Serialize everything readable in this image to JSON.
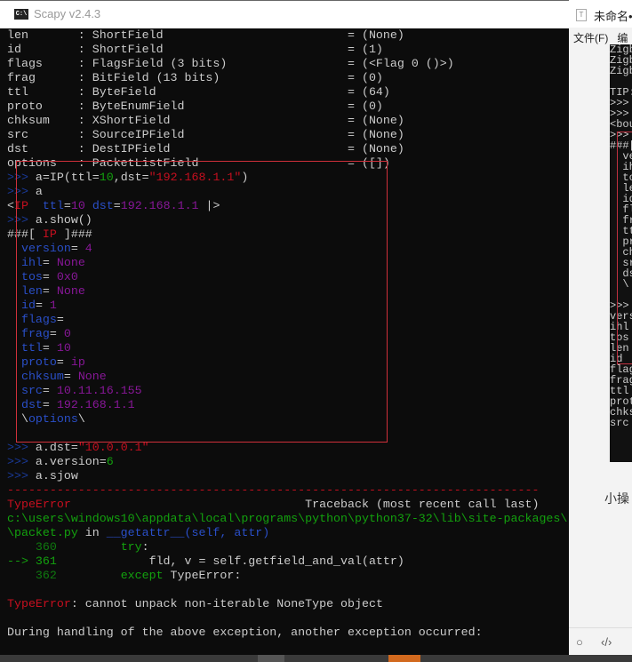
{
  "window": {
    "title": "Scapy v2.4.3",
    "icon": "cmd-icon"
  },
  "terminal": {
    "lines": [
      [
        [
          "w",
          "len       : ShortField                          = (None)"
        ]
      ],
      [
        [
          "w",
          "id        : ShortField                          = (1)"
        ]
      ],
      [
        [
          "w",
          "flags     : FlagsField (3 bits)                 = (<Flag 0 ()>)"
        ]
      ],
      [
        [
          "w",
          "frag      : BitField (13 bits)                  = (0)"
        ]
      ],
      [
        [
          "w",
          "ttl       : ByteField                           = (64)"
        ]
      ],
      [
        [
          "w",
          "proto     : ByteEnumField                       = (0)"
        ]
      ],
      [
        [
          "w",
          "chksum    : XShortField                         = (None)"
        ]
      ],
      [
        [
          "w",
          "src       : SourceIPField                       = (None)"
        ]
      ],
      [
        [
          "w",
          "dst       : DestIPField                         = (None)"
        ]
      ],
      [
        [
          "w",
          "options   : PacketListField                     = ([])"
        ]
      ],
      [
        [
          "p",
          ">>> "
        ],
        [
          "w",
          "a=IP(ttl="
        ],
        [
          "g",
          "10"
        ],
        [
          "w",
          ",dst="
        ],
        [
          "r",
          "\"192.168.1.1\""
        ],
        [
          "w",
          ")"
        ]
      ],
      [
        [
          "p",
          ">>> "
        ],
        [
          "w",
          "a"
        ]
      ],
      [
        [
          "w",
          "<"
        ],
        [
          "r",
          "IP"
        ],
        [
          "w",
          "  "
        ],
        [
          "b",
          "ttl"
        ],
        [
          "w",
          "="
        ],
        [
          "m",
          "10"
        ],
        [
          "w",
          " "
        ],
        [
          "b",
          "dst"
        ],
        [
          "w",
          "="
        ],
        [
          "m",
          "192.168.1.1"
        ],
        [
          "w",
          " |>"
        ]
      ],
      [
        [
          "p",
          ">>> "
        ],
        [
          "w",
          "a.show()"
        ]
      ],
      [
        [
          "w",
          "###[ "
        ],
        [
          "r",
          "IP"
        ],
        [
          "w",
          " ]###"
        ]
      ],
      [
        [
          "w",
          "  "
        ],
        [
          "b",
          "version"
        ],
        [
          "w",
          "= "
        ],
        [
          "m",
          "4"
        ]
      ],
      [
        [
          "w",
          "  "
        ],
        [
          "b",
          "ihl"
        ],
        [
          "w",
          "= "
        ],
        [
          "m",
          "None"
        ]
      ],
      [
        [
          "w",
          "  "
        ],
        [
          "b",
          "tos"
        ],
        [
          "w",
          "= "
        ],
        [
          "m",
          "0x0"
        ]
      ],
      [
        [
          "w",
          "  "
        ],
        [
          "b",
          "len"
        ],
        [
          "w",
          "= "
        ],
        [
          "m",
          "None"
        ]
      ],
      [
        [
          "w",
          "  "
        ],
        [
          "b",
          "id"
        ],
        [
          "w",
          "= "
        ],
        [
          "m",
          "1"
        ]
      ],
      [
        [
          "w",
          "  "
        ],
        [
          "b",
          "flags"
        ],
        [
          "w",
          "= "
        ]
      ],
      [
        [
          "w",
          "  "
        ],
        [
          "b",
          "frag"
        ],
        [
          "w",
          "= "
        ],
        [
          "m",
          "0"
        ]
      ],
      [
        [
          "w",
          "  "
        ],
        [
          "b",
          "ttl"
        ],
        [
          "w",
          "= "
        ],
        [
          "m",
          "10"
        ]
      ],
      [
        [
          "w",
          "  "
        ],
        [
          "b",
          "proto"
        ],
        [
          "w",
          "= "
        ],
        [
          "m",
          "ip"
        ]
      ],
      [
        [
          "w",
          "  "
        ],
        [
          "b",
          "chksum"
        ],
        [
          "w",
          "= "
        ],
        [
          "m",
          "None"
        ]
      ],
      [
        [
          "w",
          "  "
        ],
        [
          "b",
          "src"
        ],
        [
          "w",
          "= "
        ],
        [
          "m",
          "10.11.16.155"
        ]
      ],
      [
        [
          "w",
          "  "
        ],
        [
          "b",
          "dst"
        ],
        [
          "w",
          "= "
        ],
        [
          "m",
          "192.168.1.1"
        ]
      ],
      [
        [
          "w",
          "  \\"
        ],
        [
          "b",
          "options"
        ],
        [
          "w",
          "\\"
        ]
      ],
      [
        [
          "w",
          ""
        ]
      ],
      [
        [
          "p",
          ">>> "
        ],
        [
          "w",
          "a.dst="
        ],
        [
          "r",
          "\"10.0.0.1\""
        ]
      ],
      [
        [
          "p",
          ">>> "
        ],
        [
          "w",
          "a.version="
        ],
        [
          "g",
          "6"
        ]
      ],
      [
        [
          "p",
          ">>> "
        ],
        [
          "w",
          "a.sjow"
        ]
      ],
      [
        [
          "r",
          "---------------------------------------------------------------------------"
        ]
      ],
      [
        [
          "r",
          "TypeError"
        ],
        [
          "w",
          "                                 Traceback (most recent call last)"
        ]
      ],
      [
        [
          "g",
          "c:\\users\\windows10\\appdata\\local\\programs\\python\\python37-32\\lib\\site-packages\\"
        ]
      ],
      [
        [
          "g",
          "\\packet.py"
        ],
        [
          "w",
          " in "
        ],
        [
          "b",
          "__getattr__"
        ],
        [
          "b",
          "(self, attr)"
        ]
      ],
      [
        [
          "dg",
          "    360"
        ],
        [
          "w",
          "         "
        ],
        [
          "g",
          "try"
        ],
        [
          "w",
          ":"
        ]
      ],
      [
        [
          "g",
          "--> 361"
        ],
        [
          "w",
          "             fld, v = self.getfield_and_val(attr)"
        ]
      ],
      [
        [
          "dg",
          "    362"
        ],
        [
          "w",
          "         "
        ],
        [
          "g",
          "except"
        ],
        [
          "w",
          " TypeError:"
        ]
      ],
      [
        [
          "w",
          ""
        ]
      ],
      [
        [
          "r",
          "TypeError"
        ],
        [
          "w",
          ": cannot unpack non-iterable NoneType object"
        ]
      ],
      [
        [
          "w",
          ""
        ]
      ],
      [
        [
          "w",
          "During handling of the above exception, another exception occurred:"
        ]
      ]
    ]
  },
  "notepad": {
    "title": "未命名•",
    "menu": [
      "文件(F)",
      "编"
    ],
    "note": "小操",
    "bottom_icons": [
      "circle-icon",
      "code-icon"
    ],
    "inner_lines": [
      "Zigb",
      "Zigb",
      "Zigb",
      "",
      "TIP:",
      ">>>",
      ">>>",
      "<bou",
      ">>>",
      "###[",
      "  ve",
      "  ih",
      "  to",
      "  le",
      "  id",
      "  fl",
      "  fr",
      "  tt",
      "  pr",
      "  ch",
      "  sr",
      "  ds",
      "  \\",
      "",
      ">>>",
      "vers",
      "ihl",
      "tos",
      "len",
      "id",
      "flag",
      "frag",
      "ttl",
      "prot",
      "chks",
      "src"
    ]
  }
}
